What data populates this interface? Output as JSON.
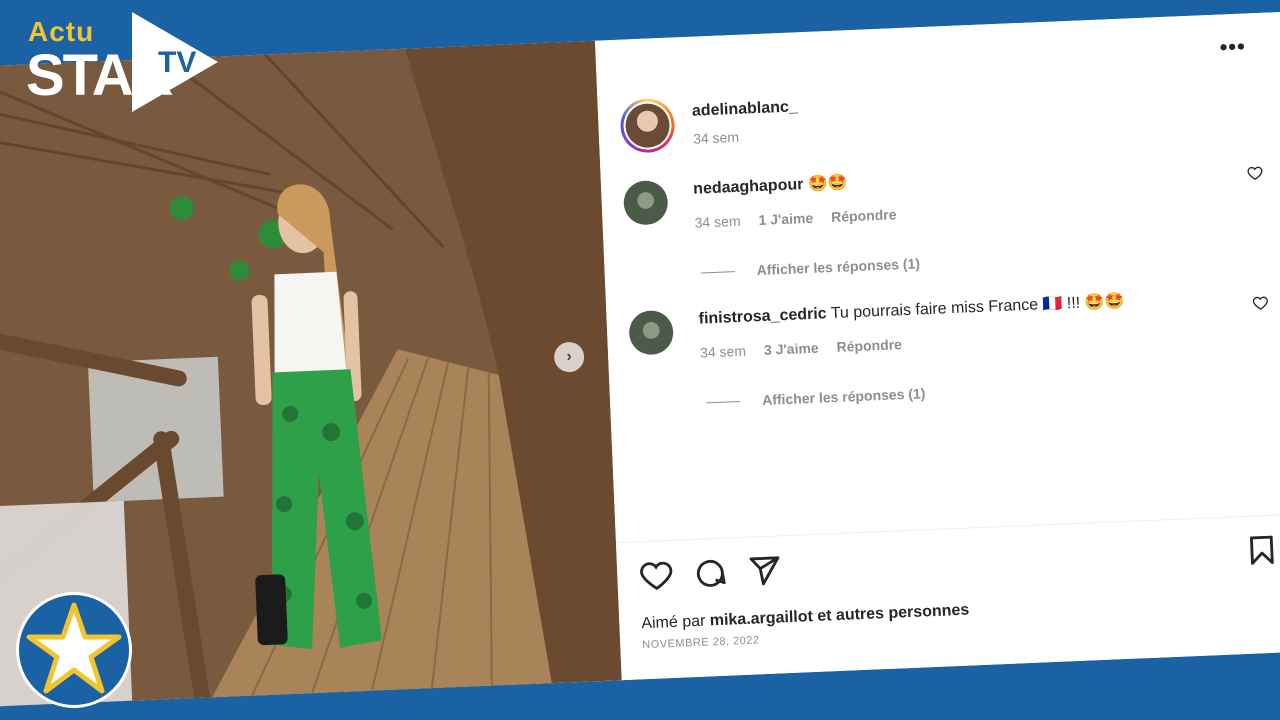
{
  "brand": {
    "actu": "Actu",
    "star": "STAR",
    "tv": "TV"
  },
  "post": {
    "owner_username": "adelinablanc_",
    "owner_time": "34 sem",
    "more_icon": "more-horizontal-icon",
    "comments": [
      {
        "username": "nedaaghapour",
        "text": "🤩🤩",
        "time": "34 sem",
        "likes": "1 J'aime",
        "reply": "Répondre",
        "view_replies": "Afficher les réponses (1)"
      },
      {
        "username": "finistrosa_cedric",
        "text": "Tu pourrais faire miss France 🇫🇷 !!! 🤩🤩",
        "time": "34 sem",
        "likes": "3 J'aime",
        "reply": "Répondre",
        "view_replies": "Afficher les réponses (1)"
      }
    ],
    "liked_by_prefix": "Aimé par",
    "liked_by_user": "mika.argaillot",
    "liked_by_suffix": "et autres personnes",
    "date": "NOVEMBRE 28, 2022"
  },
  "colors": {
    "brand_blue": "#1a62a3",
    "brand_yellow": "#f4c430"
  }
}
